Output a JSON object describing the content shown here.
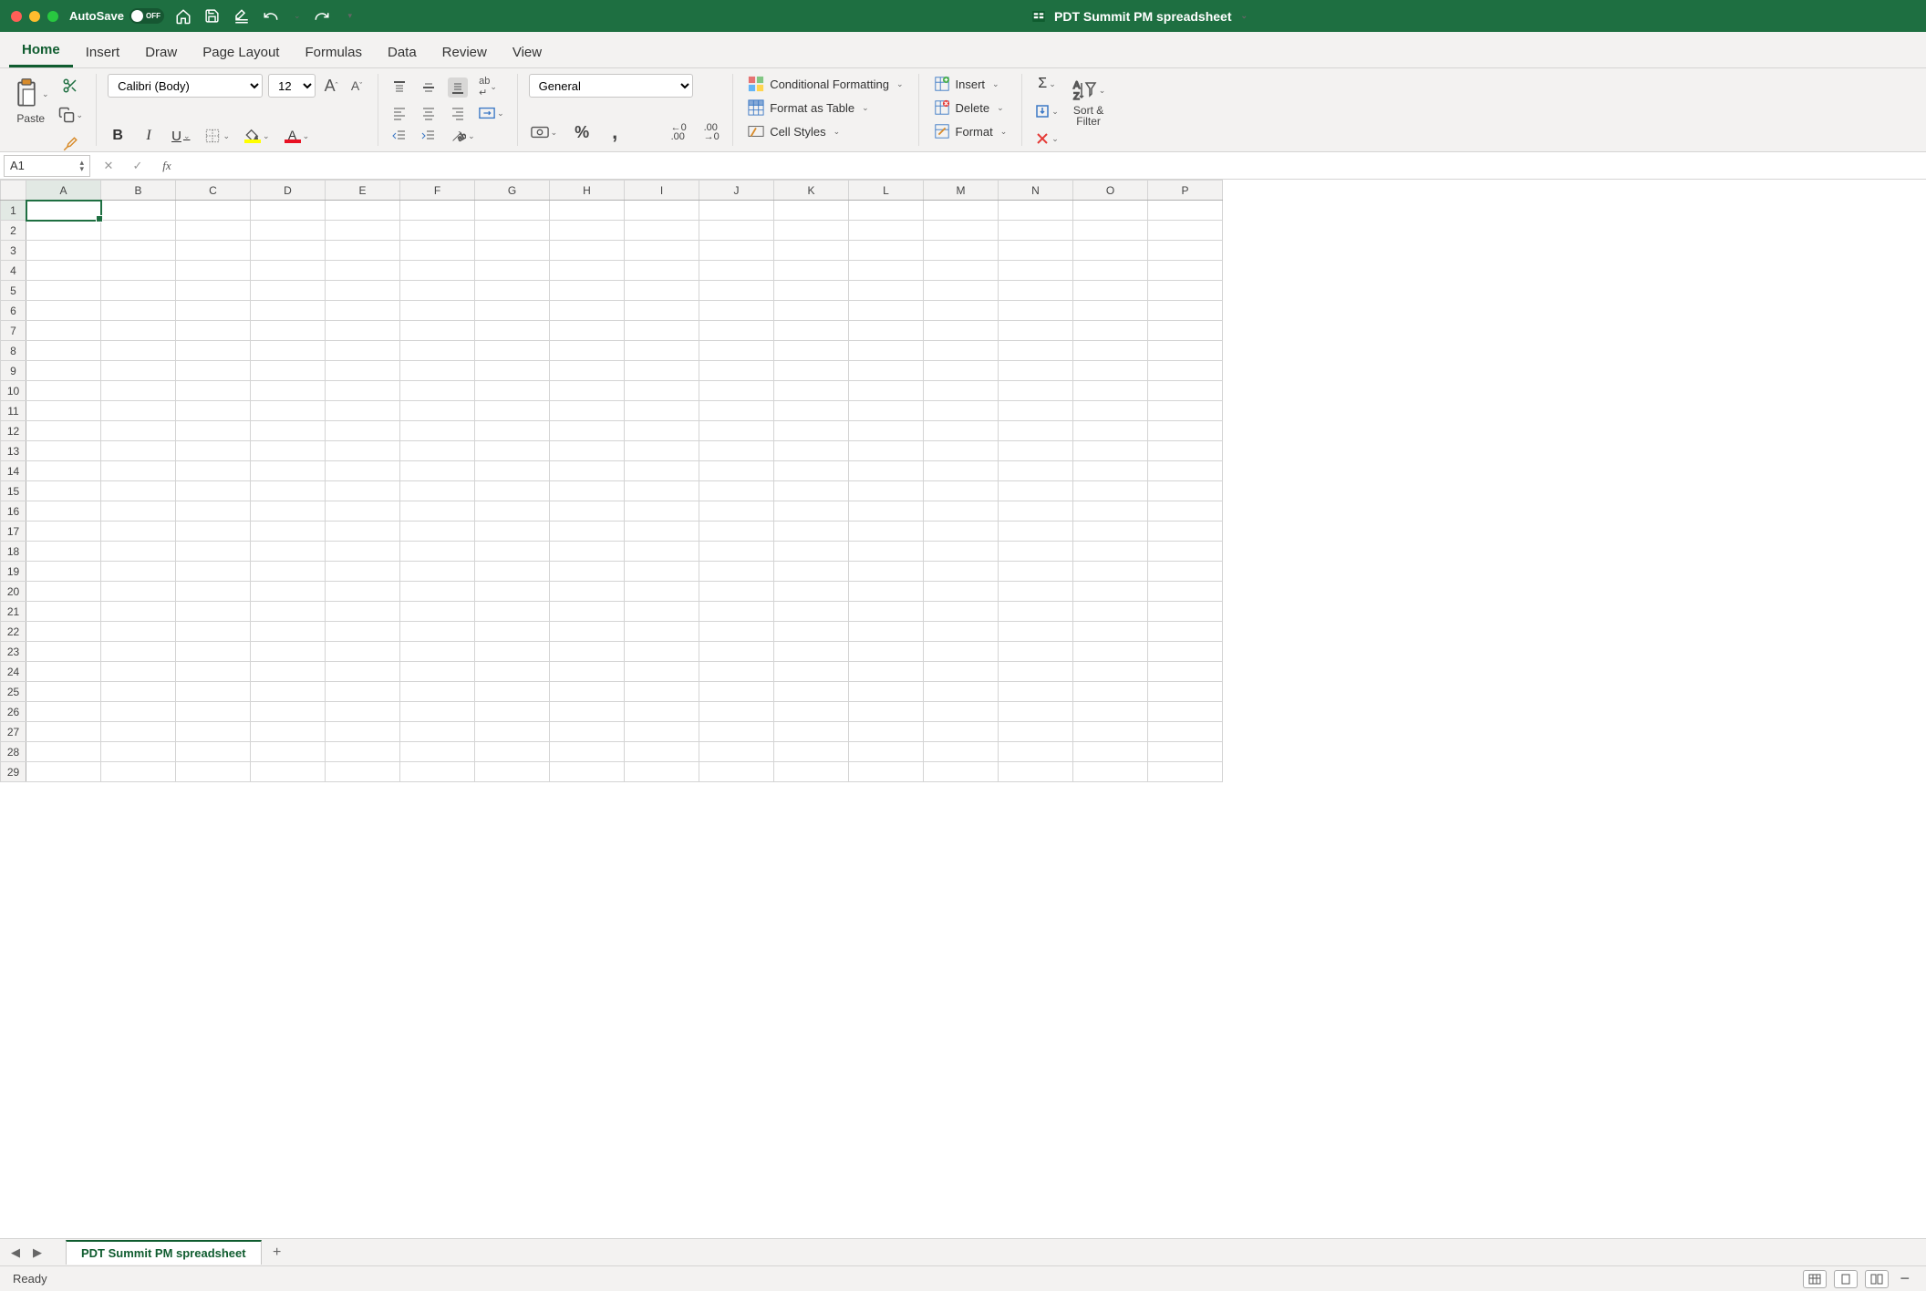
{
  "titlebar": {
    "autosave_label": "AutoSave",
    "autosave_state": "OFF",
    "doc_title": "PDT Summit PM spreadsheet"
  },
  "tabs": [
    "Home",
    "Insert",
    "Draw",
    "Page Layout",
    "Formulas",
    "Data",
    "Review",
    "View"
  ],
  "active_tab": "Home",
  "ribbon": {
    "paste_label": "Paste",
    "font_name": "Calibri (Body)",
    "font_size": "12",
    "number_format": "General",
    "cond_fmt": "Conditional Formatting",
    "fmt_table": "Format as Table",
    "cell_styles": "Cell Styles",
    "insert": "Insert",
    "delete": "Delete",
    "format": "Format",
    "sort_filter_l1": "Sort &",
    "sort_filter_l2": "Filter"
  },
  "namebox": "A1",
  "formula": "",
  "columns": [
    "A",
    "B",
    "C",
    "D",
    "E",
    "F",
    "G",
    "H",
    "I",
    "J",
    "K",
    "L",
    "M",
    "N",
    "O",
    "P"
  ],
  "row_count": 29,
  "selected_cell": {
    "row": 1,
    "col": "A"
  },
  "sheet_tab": "PDT Summit PM spreadsheet",
  "status": "Ready"
}
